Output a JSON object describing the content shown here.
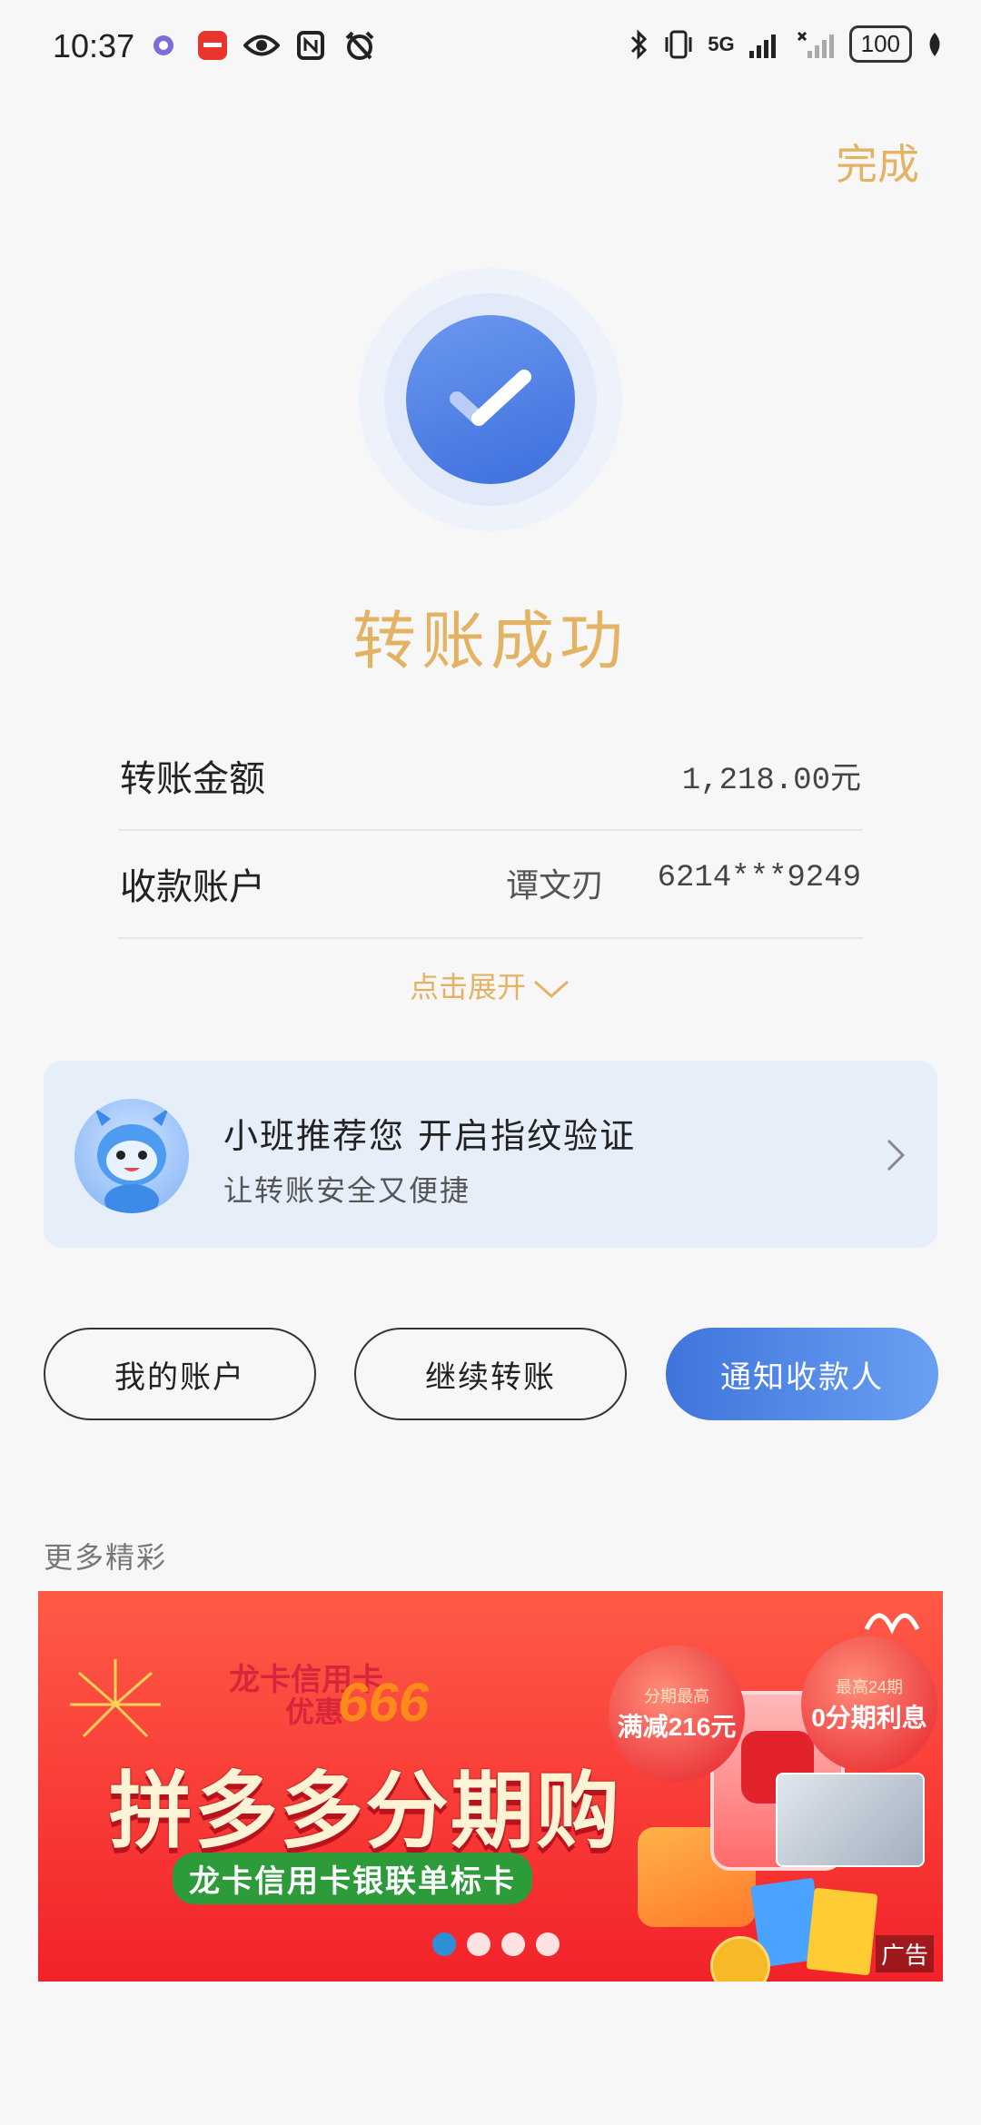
{
  "status_bar": {
    "time": "10:37",
    "network": "5G",
    "battery": "100",
    "left_icons": [
      "app-badge-icon",
      "huawei-app-icon",
      "eye-icon",
      "nfc-icon",
      "alarm-off-icon"
    ],
    "right_icons": [
      "bluetooth-icon",
      "vibrate-icon",
      "signal-icon",
      "no-signal-icon",
      "battery-icon",
      "leaf-icon"
    ]
  },
  "header": {
    "done_label": "完成"
  },
  "result": {
    "title": "转账成功"
  },
  "details": {
    "amount_label": "转账金额",
    "amount_value": "1,218.00元",
    "account_label": "收款账户",
    "payee_name": "谭文刃",
    "payee_account": "6214***9249",
    "expand_label": "点击展开"
  },
  "recommend": {
    "title": "小班推荐您  开启指纹验证",
    "subtitle": "让转账安全又便捷"
  },
  "actions": {
    "my_account": "我的账户",
    "continue_transfer": "继续转账",
    "notify_payee": "通知收款人"
  },
  "more": {
    "label": "更多精彩"
  },
  "banner": {
    "line1": "龙卡信用卡",
    "line2": "优惠",
    "number": "666",
    "title": "拼多多分期购",
    "tag": "龙卡信用卡银联单标卡",
    "bubble_left_small": "分期最高",
    "bubble_left_big": "满减216元",
    "bubble_right_small": "最高24期",
    "bubble_right_big": "0分期利息",
    "ad_label": "广告",
    "dots": 4,
    "active_dot": 0
  },
  "colors": {
    "gold": "#e3b363",
    "blue": "#3f74dc",
    "card_bg": "#e6eef9",
    "page_bg": "#f7f7f8"
  }
}
